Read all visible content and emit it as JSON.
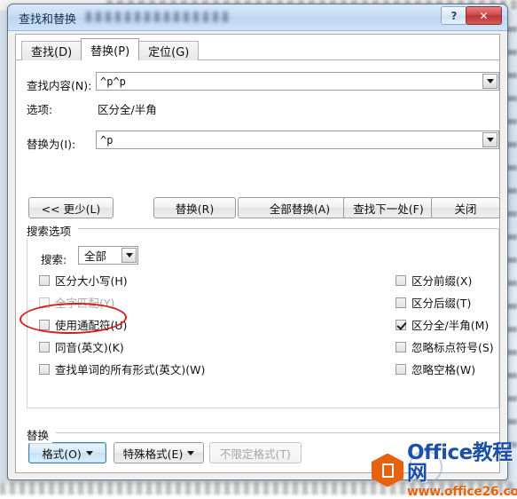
{
  "window": {
    "title": "查找和替换",
    "help_button": "?",
    "close_button": "✕"
  },
  "tabs": [
    {
      "label": "查找(D)",
      "active": false
    },
    {
      "label": "替换(P)",
      "active": true
    },
    {
      "label": "定位(G)",
      "active": false
    }
  ],
  "form": {
    "find_label": "查找内容(N):",
    "find_value": "^p^p",
    "options_label": "选项:",
    "options_value": "区分全/半角",
    "replace_label": "替换为(I):",
    "replace_value": "^p"
  },
  "buttons": {
    "less": "<< 更少(L)",
    "replace": "替换(R)",
    "replace_all": "全部替换(A)",
    "find_next": "查找下一处(F)",
    "close": "关闭"
  },
  "search_options": {
    "group_title": "搜索选项",
    "search_label": "搜索:",
    "search_value": "全部",
    "left_checkboxes": [
      {
        "label": "区分大小写(H)",
        "checked": false,
        "disabled": false
      },
      {
        "label": "全字匹配(Y)",
        "checked": false,
        "disabled": true
      },
      {
        "label": "使用通配符(U)",
        "checked": false,
        "disabled": false
      },
      {
        "label": "同音(英文)(K)",
        "checked": false,
        "disabled": false
      },
      {
        "label": "查找单词的所有形式(英文)(W)",
        "checked": false,
        "disabled": false
      }
    ],
    "right_checkboxes": [
      {
        "label": "区分前缀(X)",
        "checked": false,
        "disabled": false
      },
      {
        "label": "区分后缀(T)",
        "checked": false,
        "disabled": false
      },
      {
        "label": "区分全/半角(M)",
        "checked": true,
        "disabled": false
      },
      {
        "label": "忽略标点符号(S)",
        "checked": false,
        "disabled": false
      },
      {
        "label": "忽略空格(W)",
        "checked": false,
        "disabled": false
      }
    ]
  },
  "replace_section": {
    "group_title": "替换",
    "format_button": "格式(O)",
    "special_button": "特殊格式(E)",
    "nofmt_button": "不限定格式(T)"
  },
  "annotation": {
    "highlight_target": "使用通配符(U)",
    "color": "#d81b1b"
  },
  "watermark": {
    "line1": "Office教程网",
    "line2": "www.office26.com",
    "logo_color": "#e8620d",
    "text_color": "#1b4fa8"
  }
}
